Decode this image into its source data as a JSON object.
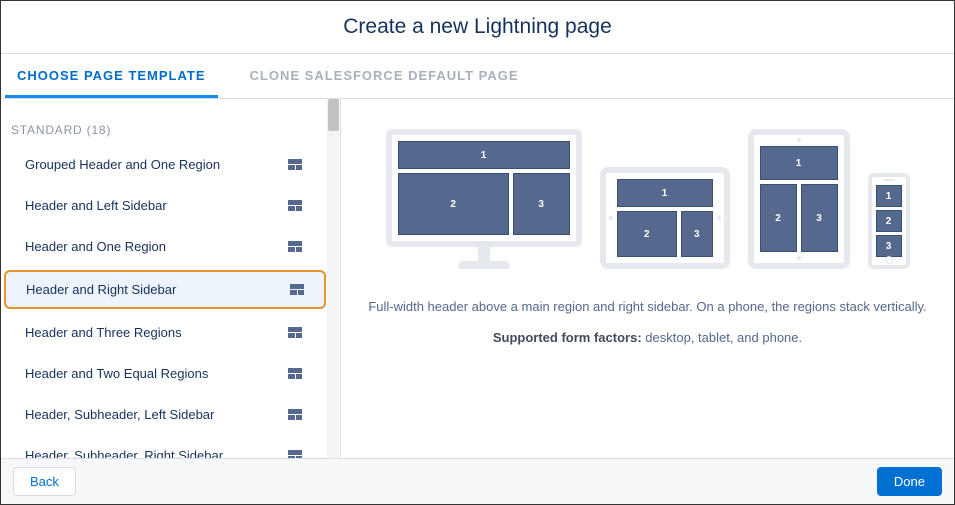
{
  "header": {
    "title": "Create a new Lightning page"
  },
  "tabs": {
    "choose": "CHOOSE PAGE TEMPLATE",
    "clone": "CLONE SALESFORCE DEFAULT PAGE"
  },
  "sidebar": {
    "section_label": "STANDARD (18)",
    "items": [
      {
        "label": "Grouped Header and One Region"
      },
      {
        "label": "Header and Left Sidebar"
      },
      {
        "label": "Header and One Region"
      },
      {
        "label": "Header and Right Sidebar"
      },
      {
        "label": "Header and Three Regions"
      },
      {
        "label": "Header and Two Equal Regions"
      },
      {
        "label": "Header, Subheader, Left Sidebar"
      },
      {
        "label": "Header, Subheader, Right Sidebar"
      }
    ],
    "selected_index": 3
  },
  "preview": {
    "regions": {
      "r1": "1",
      "r2": "2",
      "r3": "3"
    },
    "description": "Full-width header above a main region and right sidebar. On a phone, the regions stack vertically.",
    "form_factors_label": "Supported form factors:",
    "form_factors_value": "desktop, tablet, and phone."
  },
  "footer": {
    "back": "Back",
    "done": "Done"
  }
}
